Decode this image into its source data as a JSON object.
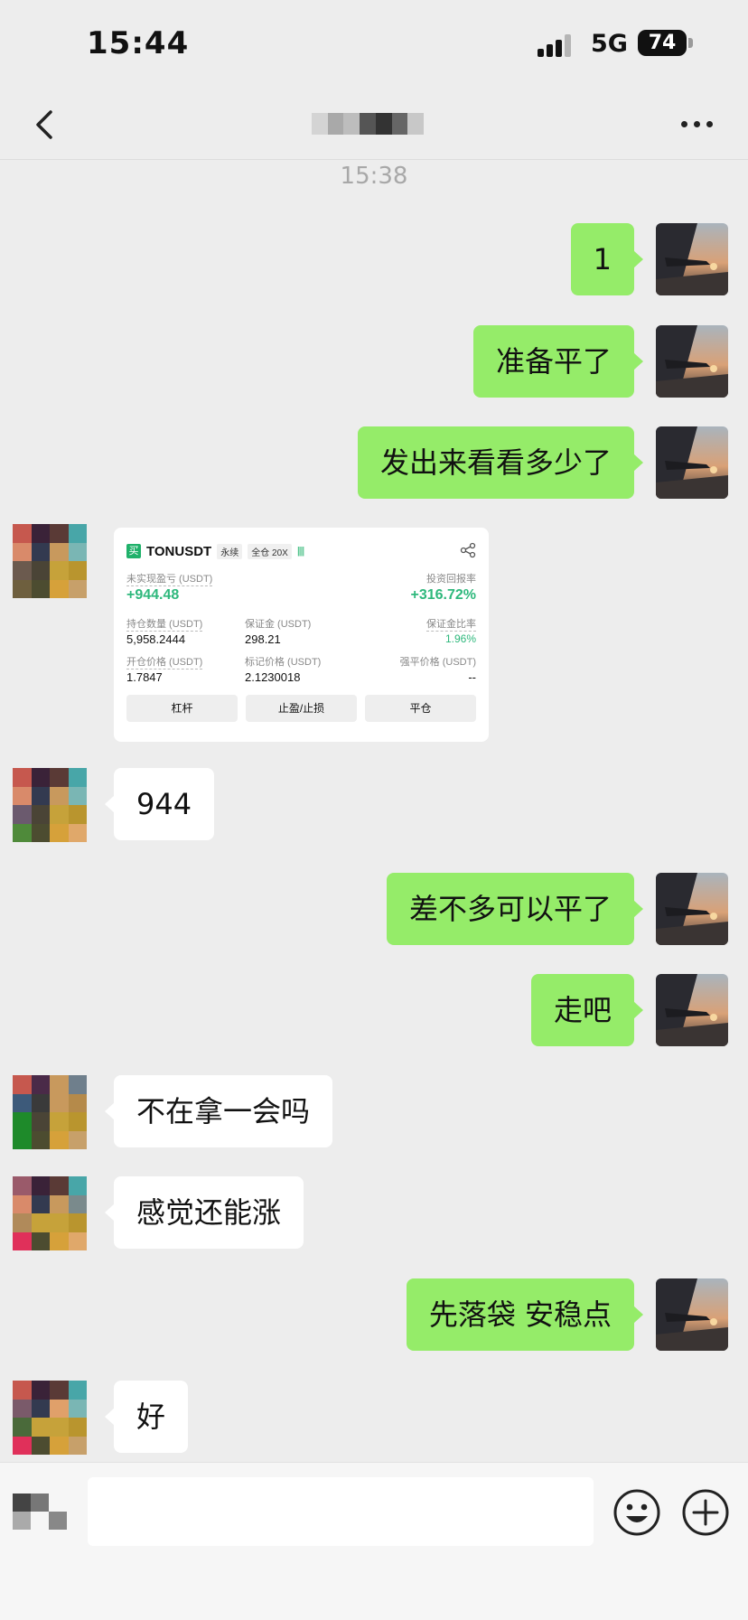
{
  "status_bar": {
    "time": "15:44",
    "network": "5G",
    "battery": "74"
  },
  "chat": {
    "timestamp": "15:38"
  },
  "messages": [
    {
      "side": "me",
      "text": "1"
    },
    {
      "side": "me",
      "text": "准备平了"
    },
    {
      "side": "me",
      "text": "发出来看看多少了"
    },
    {
      "side": "other",
      "type": "trade-card"
    },
    {
      "side": "other",
      "text": "944"
    },
    {
      "side": "me",
      "text": "差不多可以平了"
    },
    {
      "side": "me",
      "text": "走吧"
    },
    {
      "side": "other",
      "text": "不在拿一会吗"
    },
    {
      "side": "other",
      "text": "感觉还能涨"
    },
    {
      "side": "me",
      "text": "先落袋 安稳点"
    },
    {
      "side": "other",
      "text": "好"
    }
  ],
  "trade_card": {
    "logo": "买",
    "symbol": "TONUSDT",
    "tag_perpetual": "永续",
    "tag_margin": "全仓 20X",
    "tag_bars": "||||",
    "unrealized_pnl_label": "未实现盈亏 (USDT)",
    "unrealized_pnl": "+944.48",
    "roi_label": "投资回报率",
    "roi": "+316.72%",
    "position_qty_label": "持仓数量 (USDT)",
    "position_qty": "5,958.2444",
    "margin_label": "保证金 (USDT)",
    "margin": "298.21",
    "margin_ratio_label": "保证金比率",
    "margin_ratio": "1.96%",
    "entry_price_label": "开仓价格 (USDT)",
    "entry_price": "1.7847",
    "mark_price_label": "标记价格 (USDT)",
    "mark_price": "2.1230018",
    "liq_price_label": "强平价格 (USDT)",
    "liq_price": "--",
    "buttons": [
      "杠杆",
      "止盈/止损",
      "平仓"
    ]
  },
  "colors": {
    "my_bubble": "#95ec69",
    "other_bubble": "#ffffff",
    "background": "#ededed",
    "profit_green": "#2eb87c"
  },
  "icons": [
    "back-icon",
    "more-icon",
    "voice-icon",
    "emoji-icon",
    "plus-icon",
    "share-icon"
  ]
}
